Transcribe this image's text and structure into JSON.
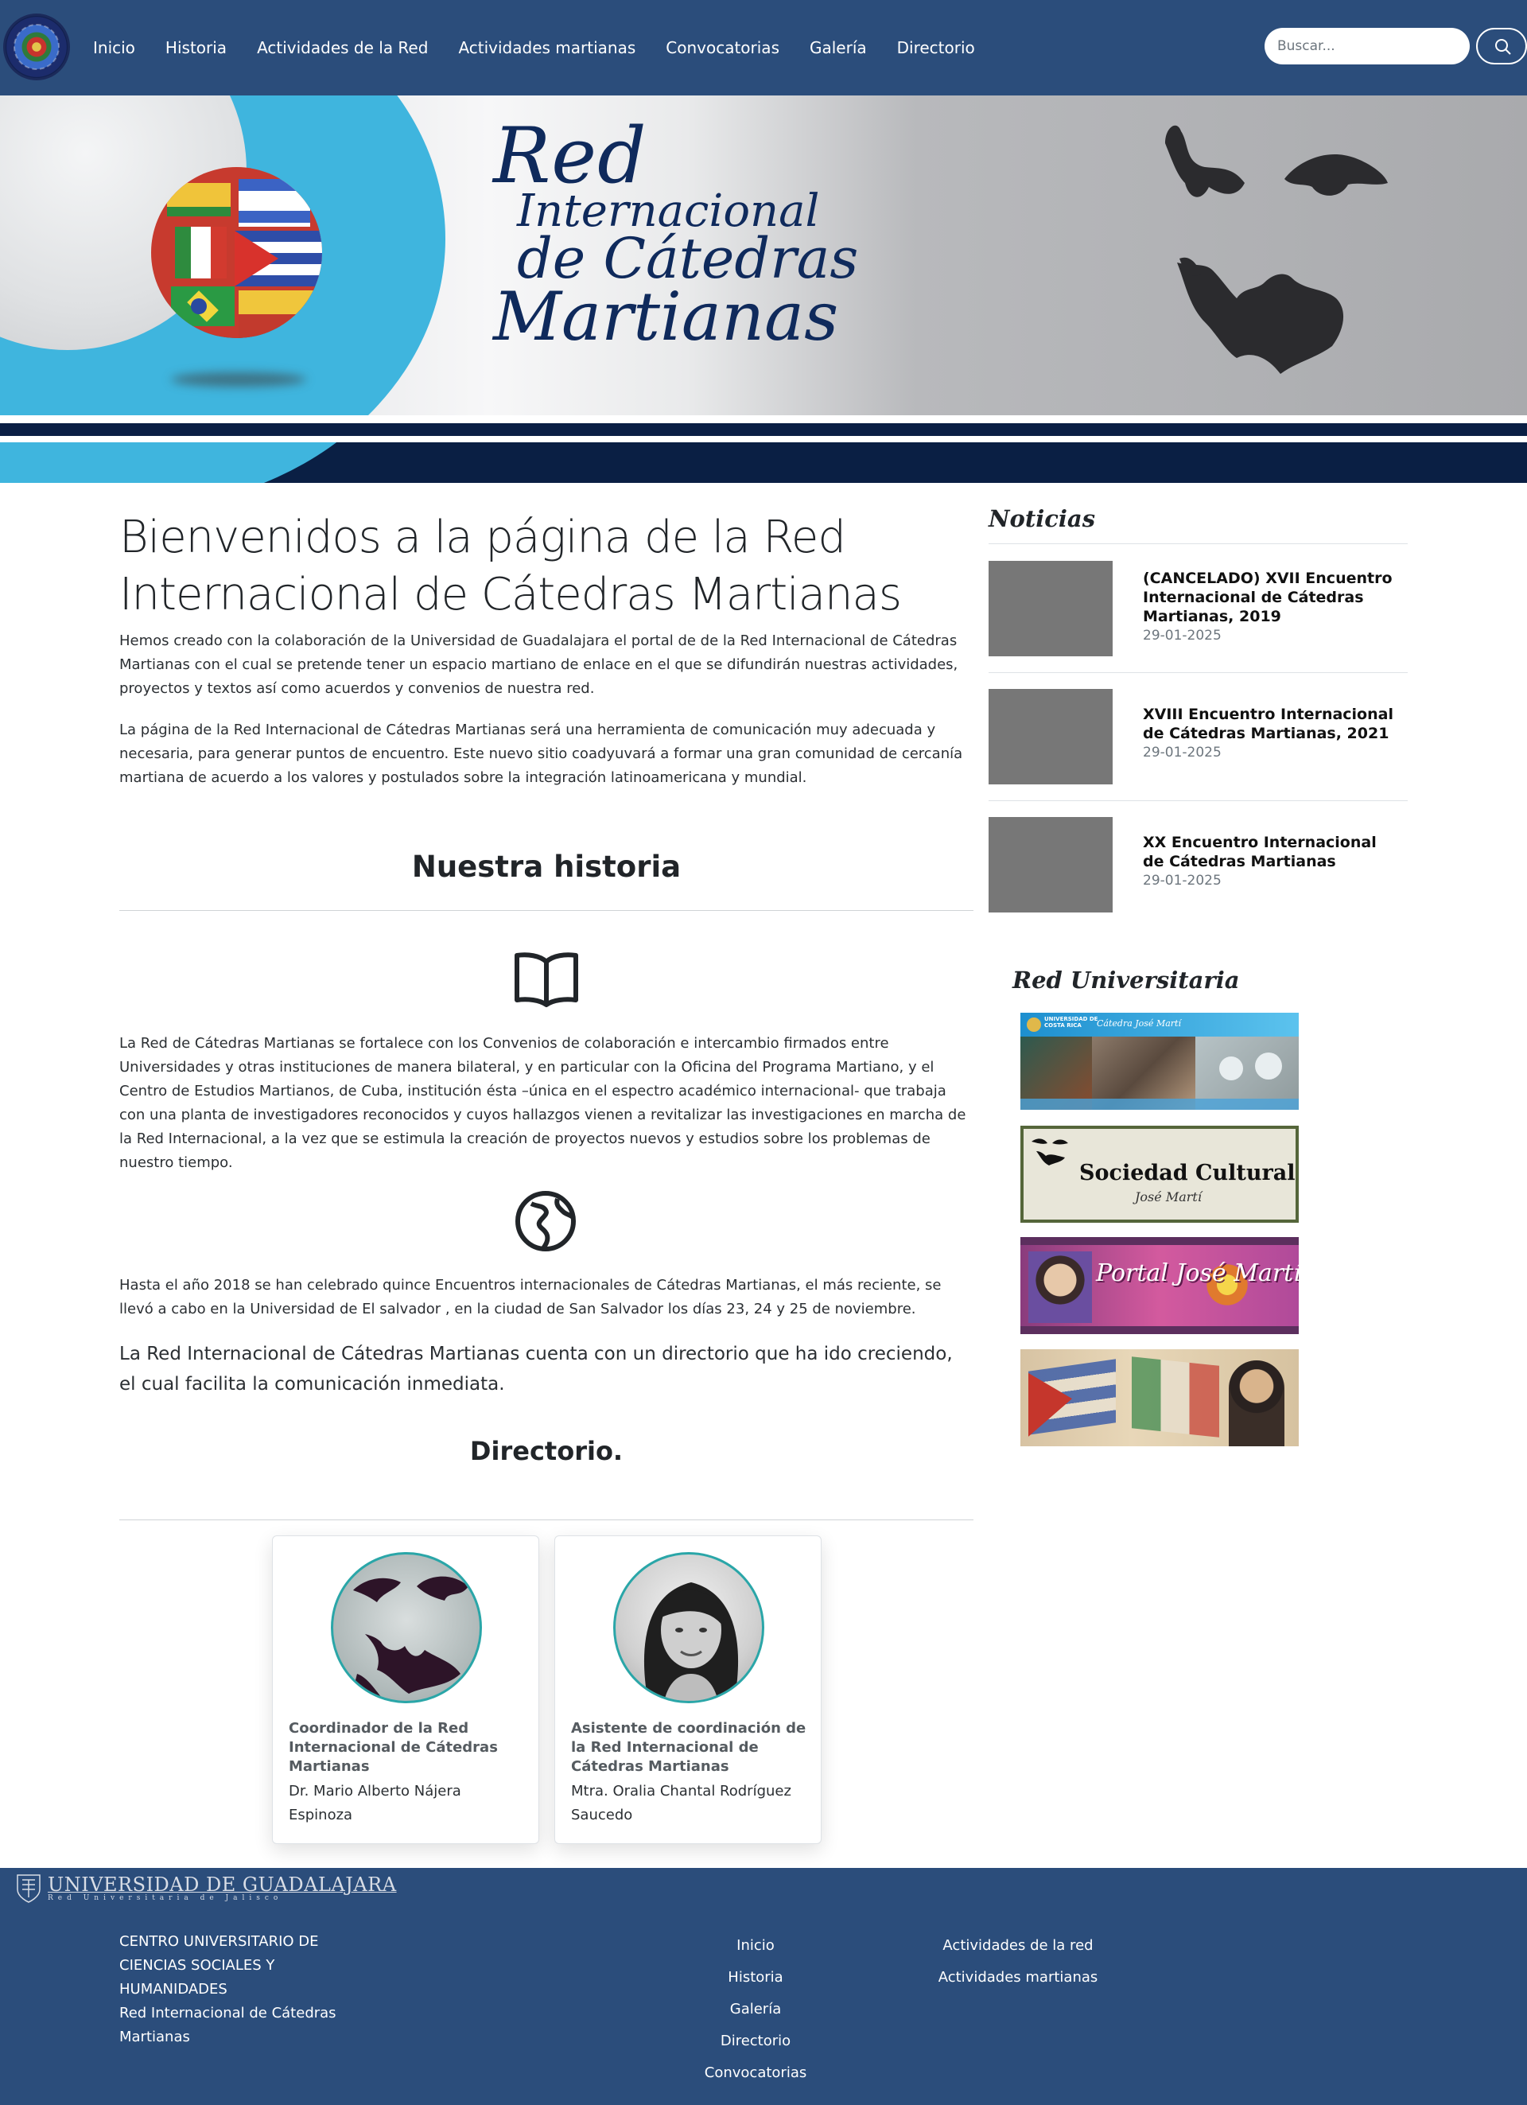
{
  "nav": {
    "items": [
      "Inicio",
      "Historia",
      "Actividades de la Red",
      "Actividades martianas",
      "Convocatorias",
      "Galería",
      "Directorio"
    ],
    "search_placeholder": "Buscar...",
    "search_icon": "search-icon"
  },
  "banner": {
    "title_line1": "Red",
    "title_line2": "Internacional",
    "title_line3": "de Cátedras",
    "title_line4": "Martianas"
  },
  "main": {
    "welcome_title": "Bienvenidos a la página de la Red Internacional de Cátedras Martianas",
    "intro_p1": "Hemos creado con la colaboración de la Universidad de Guadalajara el portal de de la Red Internacional de Cátedras Martianas con el cual se pretende tener un espacio martiano de enlace en el que se difundirán nuestras actividades, proyectos y textos así como acuerdos y convenios de nuestra red.",
    "intro_p2": "La página de la Red Internacional de Cátedras Martianas será una herramienta de comunicación muy adecuada y necesaria, para generar puntos de encuentro. Este nuevo sitio coadyuvará a formar una gran comunidad de cercanía martiana de acuerdo a los valores y postulados sobre la integración latinoamericana y mundial.",
    "historia_title": "Nuestra historia",
    "historia_p": "La Red de Cátedras Martianas se fortalece con los Convenios de colaboración e intercambio firmados entre Universidades y otras instituciones de manera bilateral, y en particular con la Oficina del Programa Martiano, y el Centro de Estudios Martianos, de Cuba, institución ésta –única en el espectro académico internacional- que trabaja con una planta de investigadores reconocidos y cuyos hallazgos vienen a revitalizar las investigaciones en marcha de la Red Internacional, a la vez que se estimula la creación de proyectos nuevos y estudios sobre los problemas de nuestro tiempo.",
    "encuentros_p": "Hasta el año 2018 se han celebrado quince Encuentros internacionales de Cátedras Martianas, el más reciente, se llevó a cabo en la Universidad de El salvador , en la ciudad de San Salvador los días 23, 24 y 25 de noviembre.",
    "directorio_p": "La Red Internacional de Cátedras Martianas cuenta con un directorio que ha ido creciendo, el cual facilita la comunicación inmediata.",
    "directorio_title": "Directorio.",
    "cards": [
      {
        "role": "Coordinador de la Red Internacional de Cátedras Martianas",
        "name": "Dr. Mario Alberto Nájera Espinoza"
      },
      {
        "role": "Asistente de coordinación de la Red Internacional de Cátedras Martianas",
        "name": "Mtra. Oralia Chantal Rodríguez Saucedo"
      }
    ]
  },
  "sidebar": {
    "noticias_title": "Noticias",
    "news": [
      {
        "title": "(CANCELADO) XVII Encuentro Internacional de Cátedras Martianas, 2019",
        "date": "29-01-2025"
      },
      {
        "title": "XVIII Encuentro Internacional de Cátedras Martianas, 2021",
        "date": "29-01-2025"
      },
      {
        "title": "XX Encuentro Internacional de Cátedras Martianas",
        "date": "29-01-2025"
      }
    ],
    "red_title": "Red Universitaria",
    "banners": {
      "ucr_small_1": "UNIVERSIDAD DE",
      "ucr_small_2": "COSTA RICA",
      "ucr_caption": "Cátedra José Martí",
      "sociedad_title": "Sociedad Cultural",
      "sociedad_sub": "José Martí",
      "portal_text": "Portal José Martí"
    }
  },
  "footer": {
    "logo_name": "UNIVERSIDAD DE GUADALAJARA",
    "logo_sub": "Red Universitaria de Jalisco",
    "left_line1": "CENTRO UNIVERSITARIO DE CIENCIAS SOCIALES Y HUMANIDADES",
    "left_line2": "Red Internacional de Cátedras Martianas",
    "col1": [
      "Inicio",
      "Historia",
      "Galería",
      "Directorio",
      "Convocatorias"
    ],
    "col2": [
      "Actividades de la red",
      "Actividades martianas"
    ]
  },
  "colors": {
    "navbar": "#2b4d7b",
    "banner_navy": "#0a1f44",
    "banner_cyan": "#3fb5de",
    "news_thumb": "#777777",
    "avatar_border": "#2aa6a8"
  }
}
